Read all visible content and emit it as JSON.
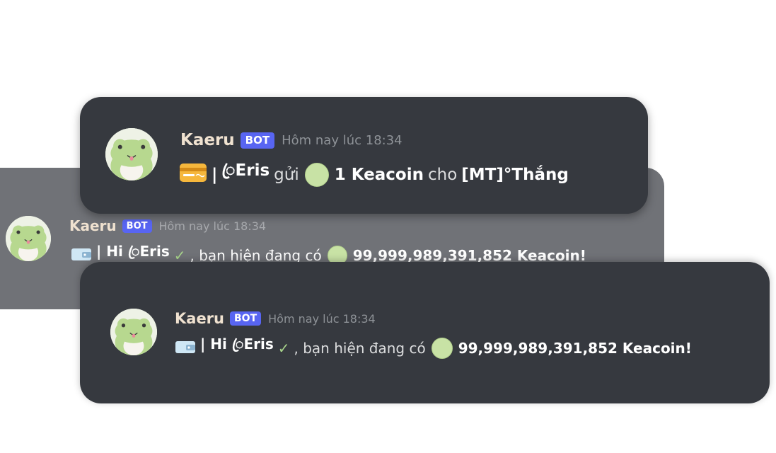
{
  "colors": {
    "card_dark": "#36393f",
    "card_back": "#707277",
    "bot_tag": "#5865f2",
    "username": "#f0e2d0",
    "timestamp": "#8e9297",
    "coin": "#c8e2a5"
  },
  "messages": [
    {
      "username": "Kaeru",
      "bot_tag": "BOT",
      "timestamp": "Hôm nay lúc 18:34",
      "icon": "credit-card-icon",
      "content": {
        "sep": "|",
        "sender": "ꦿEris",
        "verb": "gửi",
        "amount": "1 Keacoin",
        "prep": "cho",
        "recipient": "[MT]°Thắng"
      }
    },
    {
      "username": "Kaeru",
      "bot_tag": "BOT",
      "timestamp": "Hôm nay lúc 18:34",
      "icon": "wallet-icon",
      "content": {
        "greeting": "| Hi ꦿEris",
        "mid": ", bạn hiện đang có",
        "balance": "99,999,989,391,852 Keacoin!"
      }
    },
    {
      "username": "Kaeru",
      "bot_tag": "BOT",
      "timestamp": "Hôm nay lúc 18:34",
      "icon": "wallet-icon",
      "content": {
        "greeting": "| Hi ꦿEris",
        "mid": ", bạn hiện đang có",
        "balance": "99,999,989,391,852 Keacoin!"
      }
    }
  ]
}
